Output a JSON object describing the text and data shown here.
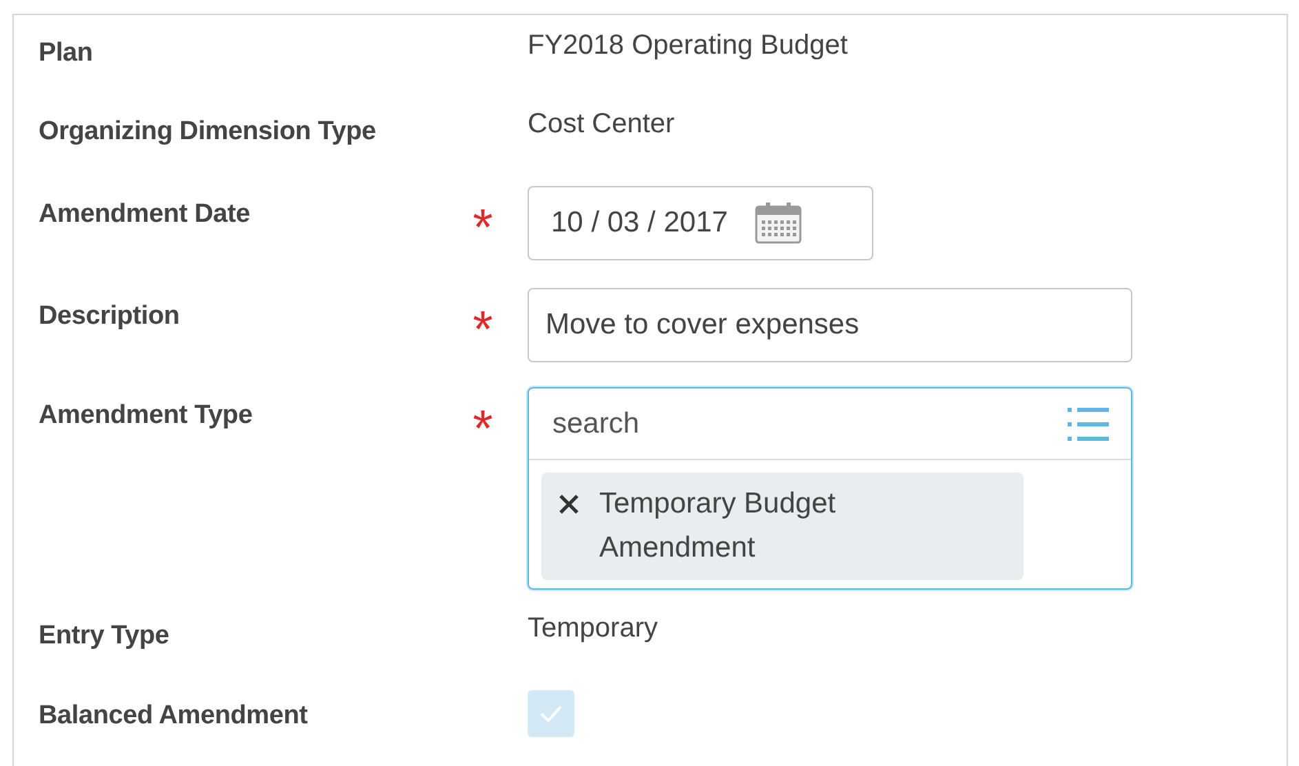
{
  "form": {
    "rows": [
      {
        "kind": "text",
        "label": "Plan",
        "required": false,
        "value": "FY2018 Operating Budget"
      },
      {
        "kind": "text",
        "label": "Organizing Dimension Type",
        "required": false,
        "value": "Cost Center"
      },
      {
        "kind": "date",
        "label": "Amendment Date",
        "required": true,
        "value": "10 / 03 / 2017"
      },
      {
        "kind": "input",
        "label": "Description",
        "required": true,
        "value": "Move to cover expenses"
      },
      {
        "kind": "multiselect",
        "label": "Amendment Type",
        "required": true,
        "placeholder": "search",
        "focused": true,
        "selections": [
          {
            "label": "Temporary Budget Amendment"
          }
        ]
      },
      {
        "kind": "text",
        "label": "Entry Type",
        "required": false,
        "value": "Temporary"
      },
      {
        "kind": "checkbox",
        "label": "Balanced Amendment",
        "required": false,
        "checked": true,
        "disabled": true
      }
    ]
  }
}
